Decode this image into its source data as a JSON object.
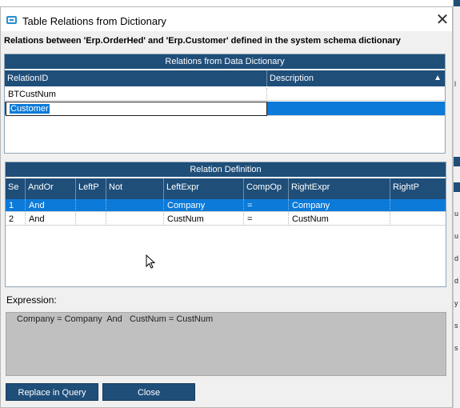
{
  "dialog": {
    "title": "Table Relations from Dictionary",
    "close_icon": "close-icon",
    "subheader": "Relations between 'Erp.OrderHed' and 'Erp.Customer' defined in the system schema dictionary"
  },
  "dictionary_grid": {
    "caption": "Relations from Data Dictionary",
    "columns": [
      "RelationID",
      "Description"
    ],
    "sort_icon": "sort-ascending-icon",
    "rows": [
      {
        "relation_id": "BTCustNum",
        "description": ""
      },
      {
        "relation_id": "Customer",
        "description": ""
      }
    ],
    "selected_row": 1
  },
  "definition_grid": {
    "caption": "Relation Definition",
    "columns": [
      "Se",
      "AndOr",
      "LeftP",
      "Not",
      "LeftExpr",
      "CompOp",
      "RightExpr",
      "RightP"
    ],
    "rows": [
      {
        "seq": "1",
        "andor": "And",
        "leftp": "",
        "not": "",
        "leftexpr": "Company",
        "compop": "=",
        "rightexpr": "Company",
        "rightp": ""
      },
      {
        "seq": "2",
        "andor": "And",
        "leftp": "",
        "not": "",
        "leftexpr": "CustNum",
        "compop": "=",
        "rightexpr": "CustNum",
        "rightp": ""
      }
    ],
    "selected_row": 0
  },
  "expression": {
    "label": "Expression:",
    "text": "Company = Company  And   CustNum = CustNum"
  },
  "buttons": {
    "replace": "Replace in Query",
    "close": "Close"
  },
  "colors": {
    "header_bg": "#1f4e79",
    "selection": "#0c7ad9",
    "expression_bg": "#c0c0c0"
  }
}
